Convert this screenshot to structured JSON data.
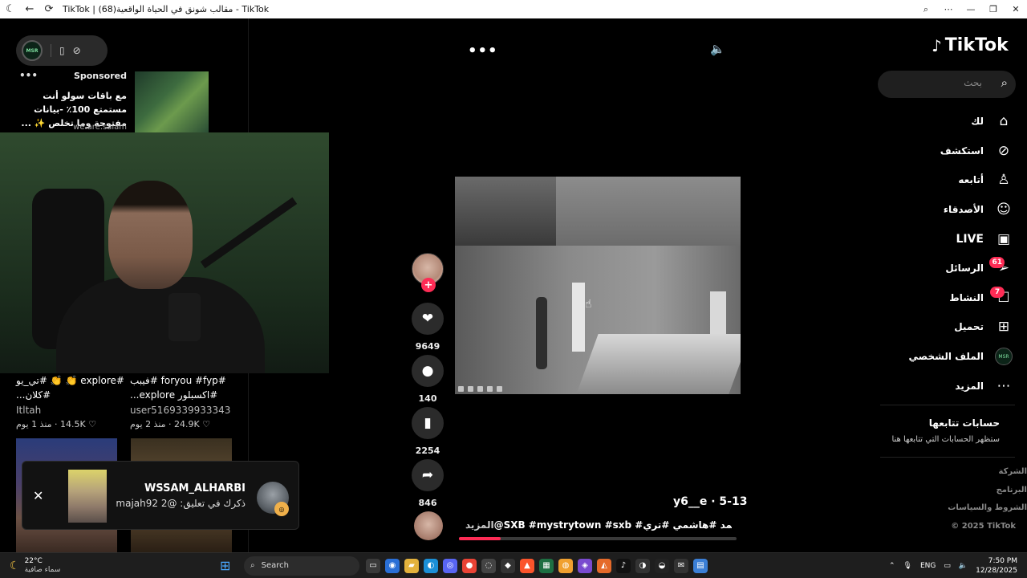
{
  "browser": {
    "title": "TikTok | مقالب شونق في الحياة الواقعية(68) - TikTok",
    "back_icon": "back-arrow-icon",
    "reload_icon": "reload-icon"
  },
  "left": {
    "sponsored": {
      "dots": "•••",
      "label": "Sponsored",
      "text": "مع باقات سولو أنت مستمتع 100٪ -بيانات مفتوحة وما تخلص ✨ ...",
      "brand": "we.are.salam"
    },
    "grid": [
      {
        "caption": "#explore 👏 👏 #تي_يو #كلان...",
        "user": "Itltah",
        "likes": "14.5K",
        "age": "منذ 1 يوم"
      },
      {
        "caption": "#foryou #fyp #فيبب #اكسبلور explore...",
        "user": "user5169339933343",
        "likes": "24.9K",
        "age": "منذ 2 يوم"
      }
    ]
  },
  "notification": {
    "close": "✕",
    "name": "WSSAM_ALHARBI",
    "message": "ذكرك في تعليق: @majah92 2"
  },
  "video": {
    "more": "•••",
    "volume_icon": "volume-icon",
    "caption_user": "y6__e · 5-13",
    "caption_text": "@SXB #mystrytown #sxb #شونق #احمد #هاشمي #تري...",
    "caption_more": "المزيد",
    "progress": 0.15
  },
  "actions": {
    "follow": "+",
    "likes": "9649",
    "comments": "140",
    "saves": "2254",
    "shares": "846"
  },
  "sidebar": {
    "logo": "TikTok",
    "search_placeholder": "بحث",
    "items": [
      {
        "label": "لك",
        "icon": "home-icon"
      },
      {
        "label": "استكشف",
        "icon": "compass-icon"
      },
      {
        "label": "أتابعه",
        "icon": "user-plus-icon"
      },
      {
        "label": "الأصدقاء",
        "icon": "friends-icon"
      },
      {
        "label": "LIVE",
        "icon": "live-tv-icon"
      },
      {
        "label": "الرسائل",
        "icon": "send-icon",
        "badge": "61"
      },
      {
        "label": "النشاط",
        "icon": "activity-icon",
        "badge": "7"
      },
      {
        "label": "تحميل",
        "icon": "upload-icon"
      },
      {
        "label": "الملف الشخصي",
        "icon": "profile-avatar"
      },
      {
        "label": "المزيد",
        "icon": "more-icon"
      }
    ],
    "following_title": "حسابات تتابعها",
    "following_sub": "ستظهر الحسابات التي تتابعها هنا",
    "footer": [
      "الشركة",
      "البرنامج",
      "الشروط والسياسات",
      "© 2025 TikTok"
    ]
  },
  "taskbar": {
    "temp": "22°C",
    "condition": "سماء صافية",
    "search": "Search",
    "lang": "ENG",
    "time": "7:50 PM",
    "date": "12/28/2025"
  }
}
